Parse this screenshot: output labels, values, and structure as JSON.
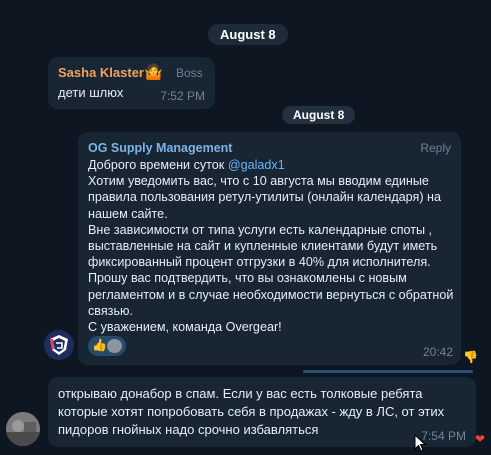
{
  "dates": {
    "top": "August 8",
    "forwarded": "August 8"
  },
  "message1": {
    "sender": "Sasha Klaster",
    "badge_emoji": "🤷",
    "role": "Boss",
    "text": "дети шлюх",
    "time": "7:52 PM"
  },
  "message2": {
    "forwarded_from": "OG Supply Management",
    "reply_label": "Reply",
    "greeting": "Доброго времени суток",
    "mention": "@galadx1",
    "lines": [
      "Хотим уведомить вас, что с 10 августа мы вводим единые",
      "правила пользования ретул-утилиты (онлайн календаря) на",
      "нашем сайте.",
      "Вне зависимости от типа услуги есть календарные споты ,",
      "выставленные на сайт и купленные клиентами будут иметь",
      "фиксированный процент отгрузки в 40% для исполнителя.",
      "Прошу вас подтвердить, что вы ознакомлены с новым",
      "регламентом и в случае необходимости вернуться с обратной",
      "связью.",
      "С уважением, команда Overgear!"
    ],
    "reactions": [
      "👍",
      "avatar"
    ],
    "time": "20:42",
    "side_reaction": "👎"
  },
  "message3": {
    "lines": [
      "открываю донабор в спам. Если у вас есть толковые ребята",
      "которые хотят попробовать себя в продажах - жду в ЛС, от этих",
      "пидоров гнойных надо срочно избавляться"
    ],
    "time": "7:54 PM",
    "reaction": "❤"
  },
  "icons": {
    "avatar_og": "og-logo-icon",
    "avatar_user": "user-avatar-icon",
    "cursor": "mouse-cursor-icon"
  },
  "colors": {
    "background": "#0e1621",
    "bubble": "#182533",
    "sender_orange": "#f2a25d",
    "link_blue": "#6ab3f3",
    "muted": "#6f8396"
  }
}
